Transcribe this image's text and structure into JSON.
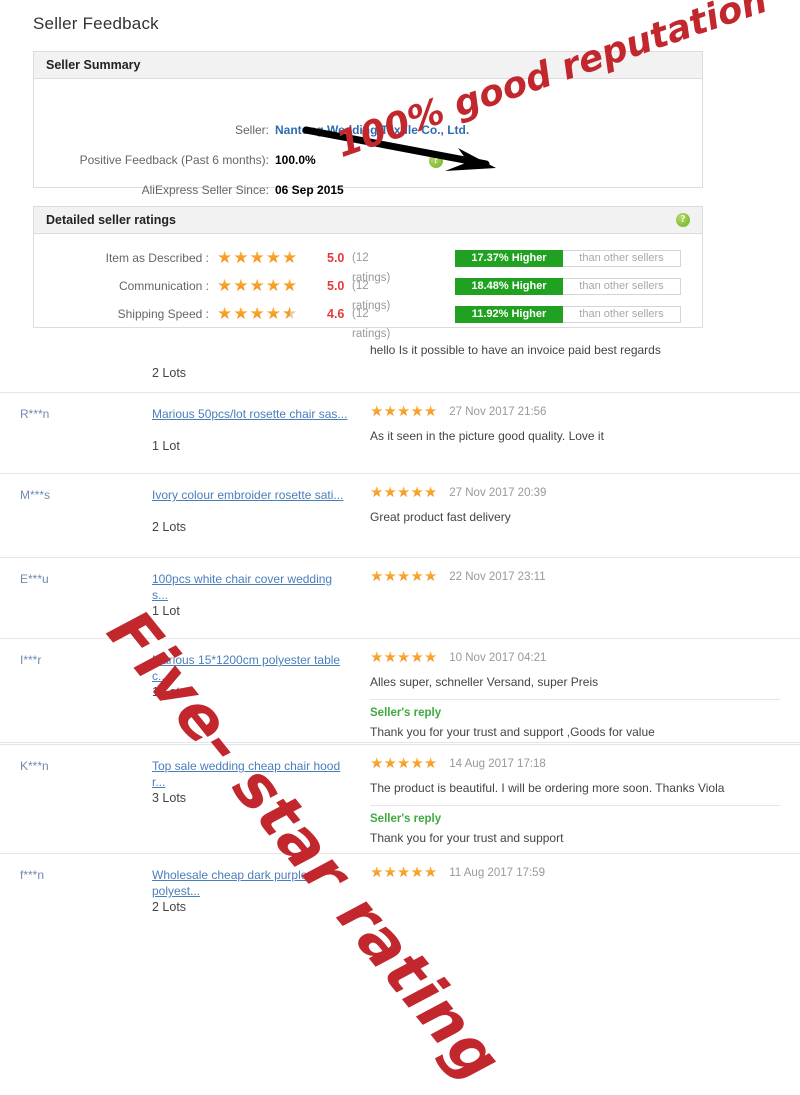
{
  "page": {
    "title": "Seller Feedback"
  },
  "seller_summary": {
    "panel_title": "Seller Summary",
    "rows": [
      {
        "label": "Seller:",
        "value": "Nantong Wedding Textile Co., Ltd.",
        "is_link": true
      },
      {
        "label": "Positive Feedback (Past 6 months):",
        "value": "100.0%",
        "is_link": false
      },
      {
        "label": "AliExpress Seller Since:",
        "value": "06 Sep 2015",
        "is_link": false
      }
    ],
    "help_icon": "help-icon"
  },
  "detailed_ratings": {
    "panel_title": "Detailed seller ratings",
    "help_icon": "help-icon",
    "comparison_suffix": "than other sellers",
    "rows": [
      {
        "label": "Item as Described :",
        "score": "5.0",
        "stars_full": 5,
        "stars_half": 0,
        "count": "(12 ratings)",
        "comparison": "17.37% Higher"
      },
      {
        "label": "Communication :",
        "score": "5.0",
        "stars_full": 5,
        "stars_half": 0,
        "count": "(12 ratings)",
        "comparison": "18.48% Higher"
      },
      {
        "label": "Shipping Speed :",
        "score": "4.6",
        "stars_full": 4,
        "stars_half": 1,
        "count": "(12 ratings)",
        "comparison": "11.92% Higher"
      }
    ]
  },
  "feedback_list": [
    {
      "user": "",
      "product": "",
      "quantity": "2 Lots",
      "stars": 0,
      "date": "",
      "comment": "hello Is it possible to have an invoice paid best regards",
      "reply_title": "",
      "reply_text": "",
      "partial": true
    },
    {
      "user": "R***n",
      "product": "Marious 50pcs/lot rosette chair sas...",
      "quantity": "1 Lot",
      "stars": 5,
      "date": "27 Nov 2017 21:56",
      "comment": "As it seen in the picture good quality. Love it",
      "reply_title": "",
      "reply_text": "",
      "partial": false
    },
    {
      "user": "M***s",
      "product": "Ivory colour embroider rosette sati...",
      "quantity": "2 Lots",
      "stars": 5,
      "date": "27 Nov 2017 20:39",
      "comment": "Great product fast delivery",
      "reply_title": "",
      "reply_text": "",
      "partial": false
    },
    {
      "user": "E***u",
      "product": "100pcs white chair cover wedding s...",
      "quantity": "1 Lot",
      "stars": 5,
      "date": "22 Nov 2017 23:11",
      "comment": "",
      "reply_title": "",
      "reply_text": "",
      "partial": false
    },
    {
      "user": "I***r",
      "product": "Marious 15*1200cm polyester table c...",
      "quantity": "1 Lot",
      "stars": 5,
      "date": "10 Nov 2017 04:21",
      "comment": "Alles super, schneller Versand, super Preis",
      "reply_title": "Seller's reply",
      "reply_text": "Thank you for your trust and support ,Goods for value",
      "partial": false
    },
    {
      "user": "K***n",
      "product": "Top sale wedding cheap chair hood r...",
      "quantity": "3 Lots",
      "stars": 5,
      "date": "14 Aug 2017 17:18",
      "comment": "The product is beautiful. I will be ordering more soon. Thanks Viola",
      "reply_title": "Seller's reply",
      "reply_text": "Thank you for your trust and support",
      "partial": false
    },
    {
      "user": "f***n",
      "product": "Wholesale cheap dark purple polyest...",
      "quantity": "2 Lots",
      "stars": 5,
      "date": "11 Aug 2017 17:59",
      "comment": "",
      "reply_title": "",
      "reply_text": "",
      "partial": false
    }
  ],
  "watermarks": {
    "reputation": "100% good reputation",
    "five_star": "Five- star rating",
    "color": "#c1272d"
  },
  "colors": {
    "link_blue": "#4a7ebb",
    "score_red": "#e4393c",
    "star_orange": "#f59a23",
    "badge_green": "#21a121",
    "reply_green": "#3faa3f"
  }
}
